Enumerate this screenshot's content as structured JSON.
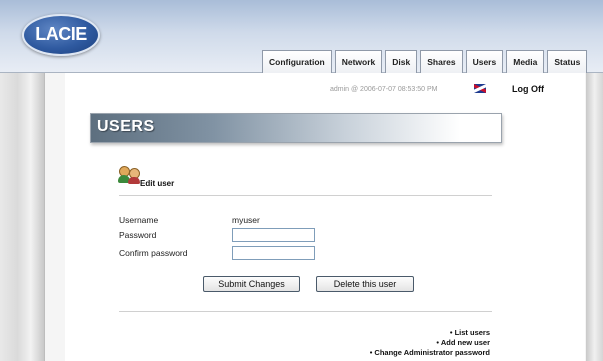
{
  "header": {
    "logo_text": "LACIE",
    "tabs": [
      {
        "label": "Configuration"
      },
      {
        "label": "Network"
      },
      {
        "label": "Disk"
      },
      {
        "label": "Shares"
      },
      {
        "label": "Users"
      },
      {
        "label": "Media"
      },
      {
        "label": "Status"
      }
    ]
  },
  "session": {
    "status": "admin @ 2006-07-07 08:53:50 PM",
    "language_icon": "uk-flag-icon",
    "logoff_label": "Log Off"
  },
  "page": {
    "title": "USERS",
    "section_icon": "users-icon",
    "section_title": "Edit user"
  },
  "form": {
    "username_label": "Username",
    "username_value": "myuser",
    "password_label": "Password",
    "password_value": "",
    "confirm_label": "Confirm password",
    "confirm_value": ""
  },
  "buttons": {
    "submit": "Submit Changes",
    "delete": "Delete this user"
  },
  "links": [
    {
      "label": "• List users"
    },
    {
      "label": "• Add new user"
    },
    {
      "label": "• Change Administrator password"
    }
  ],
  "colors": {
    "header_top": "#a9bdd8",
    "logo_blue": "#2f5aa0",
    "title_bar_dark": "#5d6f7f",
    "field_border": "#7f9db9"
  }
}
